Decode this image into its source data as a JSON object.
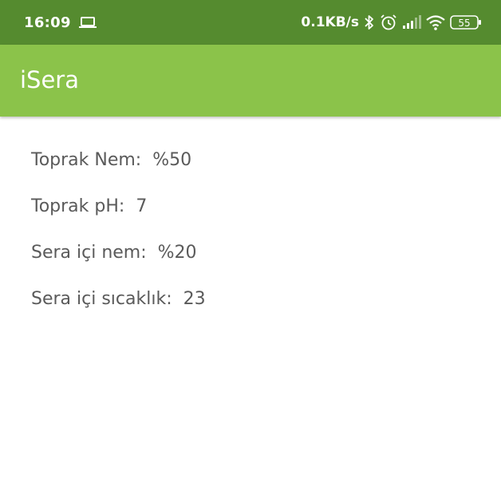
{
  "status_bar": {
    "time": "16:09",
    "net_speed": "0.1KB/s",
    "battery_level": "55",
    "icons": [
      "laptop-icon",
      "bluetooth-icon",
      "alarm-icon",
      "signal-icon",
      "wifi-icon",
      "battery-icon"
    ]
  },
  "app_bar": {
    "title": "iSera"
  },
  "readings": [
    {
      "label": "Toprak Nem:",
      "value": "%50"
    },
    {
      "label": "Toprak pH:",
      "value": "7"
    },
    {
      "label": "Sera içi nem:",
      "value": "%20"
    },
    {
      "label": "Sera içi sıcaklık:",
      "value": "23"
    }
  ],
  "colors": {
    "status_bar": "#558b2f",
    "app_bar": "#8bc34a",
    "text": "#5a5a5a"
  }
}
